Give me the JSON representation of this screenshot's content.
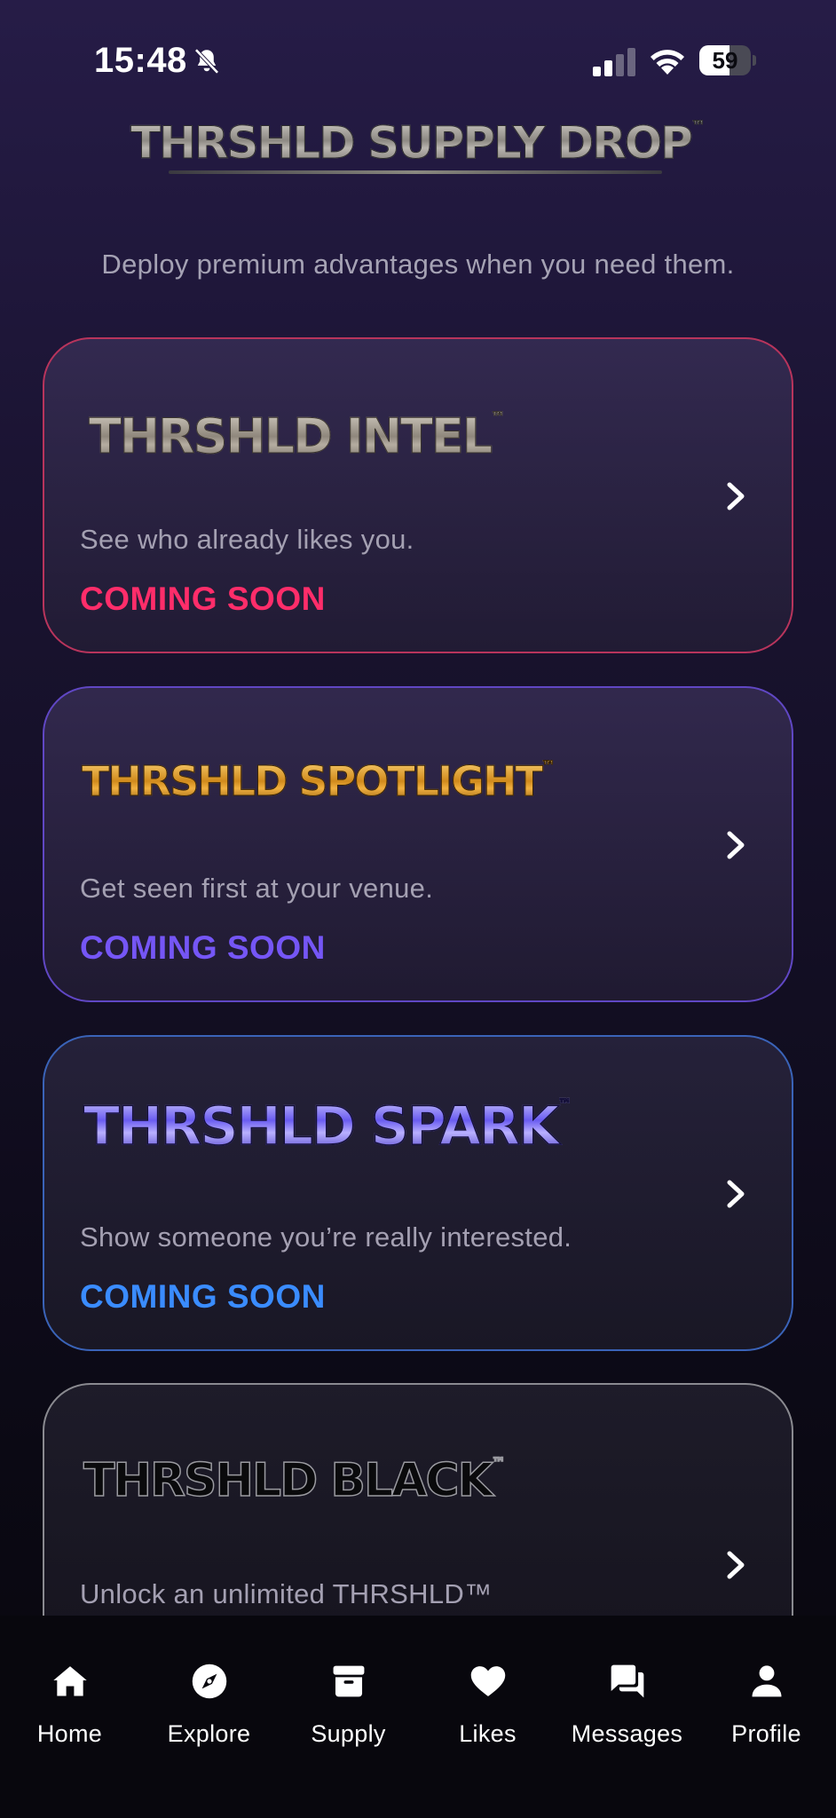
{
  "status_bar": {
    "time": "15:48",
    "battery_label": "59",
    "battery_level_percent": 59,
    "icons": [
      "bell-slash-icon",
      "signal-icon",
      "wifi-icon",
      "battery-icon"
    ]
  },
  "header": {
    "logo_text": "THRSHLD SUPPLY DROP",
    "logo_tm": "™",
    "subtitle": "Deploy premium advantages when you need them."
  },
  "cards": [
    {
      "logo_text": "THRSHLD INTEL",
      "logo_tm": "™",
      "description": "See who already likes you.",
      "status": "COMING SOON",
      "accent_color": "#ff2d6a",
      "border_color": "#b8345c"
    },
    {
      "logo_text": "THRSHLD SPOTLIGHT",
      "logo_tm": "™",
      "description": "Get seen first at your venue.",
      "status": "COMING SOON",
      "accent_color": "#7556f6",
      "border_color": "#6047c4"
    },
    {
      "logo_text": "THRSHLD SPARK",
      "logo_tm": "™",
      "description": "Show someone you’re really interested.",
      "status": "COMING SOON",
      "accent_color": "#3a8cff",
      "border_color": "#3a63b8"
    },
    {
      "logo_text": "THRSHLD BLACK",
      "logo_tm": "™",
      "description": "Unlock an unlimited THRSHLD™",
      "border_color": "#8a8a90"
    }
  ],
  "tab_bar": {
    "items": [
      {
        "label": "Home",
        "icon": "home-icon"
      },
      {
        "label": "Explore",
        "icon": "compass-icon"
      },
      {
        "label": "Supply",
        "icon": "archive-box-icon"
      },
      {
        "label": "Likes",
        "icon": "heart-icon"
      },
      {
        "label": "Messages",
        "icon": "chat-bubbles-icon"
      },
      {
        "label": "Profile",
        "icon": "person-icon"
      }
    ]
  }
}
